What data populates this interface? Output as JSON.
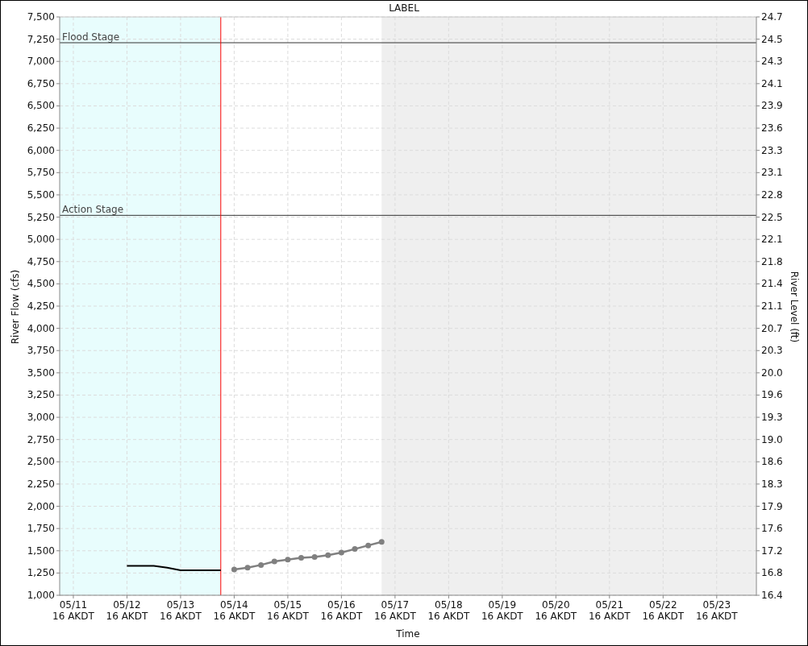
{
  "chart": {
    "chart_data": {
      "type": "line",
      "title": "LABEL",
      "xlabel": "Time",
      "ylabel": "River Flow (cfs)",
      "categories": [
        "05/11 16 AKDT",
        null,
        null,
        null,
        "05/12 16 AKDT",
        null,
        null,
        null,
        "05/13 16 AKDT",
        null,
        null,
        null,
        "05/14 16 AKDT",
        null,
        null,
        null,
        "05/15 16 AKDT",
        null,
        null,
        null,
        "05/16 16 AKDT",
        null,
        null,
        null,
        "05/17 16 AKDT",
        null,
        null,
        null,
        "05/18 16 AKDT",
        null,
        null,
        null,
        "05/19 16 AKDT",
        null,
        null,
        null,
        "05/20 16 AKDT",
        null,
        null,
        null,
        "05/21 16 AKDT",
        null,
        null,
        null,
        "05/22 16 AKDT",
        null,
        null,
        null,
        "05/23 16 AKDT",
        null,
        null
      ],
      "series": [
        {
          "color": "#000000",
          "marker": "none",
          "values": [
            null,
            null,
            null,
            null,
            1330,
            1330,
            1330,
            1310,
            1280,
            1280,
            1280,
            1280,
            null,
            null,
            null,
            null,
            null,
            null,
            null,
            null,
            null,
            null,
            null,
            null,
            null,
            null,
            null,
            null,
            null,
            null,
            null,
            null,
            null,
            null,
            null,
            null,
            null,
            null,
            null,
            null,
            null,
            null,
            null,
            null,
            null,
            null,
            null,
            null,
            null,
            null,
            null
          ]
        },
        {
          "color": "#808080",
          "marker": "circle",
          "values": [
            null,
            null,
            null,
            null,
            null,
            null,
            null,
            null,
            null,
            null,
            null,
            null,
            1290,
            1310,
            1340,
            1380,
            1400,
            1420,
            1430,
            1450,
            1480,
            1520,
            1560,
            1600,
            null,
            null,
            null,
            null,
            null,
            null,
            null,
            null,
            null,
            null,
            null,
            null,
            null,
            null,
            null,
            null,
            null,
            null,
            null,
            null,
            null,
            null,
            null,
            null,
            null,
            null,
            null
          ]
        }
      ],
      "grid": true,
      "ylim": [
        1000,
        7500
      ],
      "yticks": [
        {
          "value": 1000,
          "label": "1,000"
        },
        {
          "value": 1250,
          "label": "1,250"
        },
        {
          "value": 1500,
          "label": "1,500"
        },
        {
          "value": 1750,
          "label": "1,750"
        },
        {
          "value": 2000,
          "label": "2,000"
        },
        {
          "value": 2250,
          "label": "2,250"
        },
        {
          "value": 2500,
          "label": "2,500"
        },
        {
          "value": 2750,
          "label": "2,750"
        },
        {
          "value": 3000,
          "label": "3,000"
        },
        {
          "value": 3250,
          "label": "3,250"
        },
        {
          "value": 3500,
          "label": "3,500"
        },
        {
          "value": 3750,
          "label": "3,750"
        },
        {
          "value": 4000,
          "label": "4,000"
        },
        {
          "value": 4250,
          "label": "4,250"
        },
        {
          "value": 4500,
          "label": "4,500"
        },
        {
          "value": 4750,
          "label": "4,750"
        },
        {
          "value": 5000,
          "label": "5,000"
        },
        {
          "value": 5250,
          "label": "5,250"
        },
        {
          "value": 5500,
          "label": "5,500"
        },
        {
          "value": 5750,
          "label": "5,750"
        },
        {
          "value": 6000,
          "label": "6,000"
        },
        {
          "value": 6250,
          "label": "6,250"
        },
        {
          "value": 6500,
          "label": "6,500"
        },
        {
          "value": 6750,
          "label": "6,750"
        },
        {
          "value": 7000,
          "label": "7,000"
        },
        {
          "value": 7250,
          "label": "7,250"
        },
        {
          "value": 7500,
          "label": "7,500"
        }
      ],
      "ref_lines": [
        {
          "axis": "y",
          "value": 7210,
          "label": "Flood Stage"
        },
        {
          "axis": "y",
          "value": 5270,
          "label": "Action Stage"
        }
      ]
    },
    "right_axis": {
      "title": "River Level (ft)",
      "labels": [
        "24.7",
        "24.5",
        "24.3",
        "24.1",
        "23.9",
        "23.6",
        "23.3",
        "23.1",
        "22.8",
        "22.5",
        "22.1",
        "21.8",
        "21.4",
        "21.1",
        "20.7",
        "20.3",
        "20.0",
        "19.6",
        "19.3",
        "19.0",
        "18.6",
        "18.3",
        "17.9",
        "17.6",
        "17.2",
        "16.8",
        "16.4"
      ]
    }
  }
}
